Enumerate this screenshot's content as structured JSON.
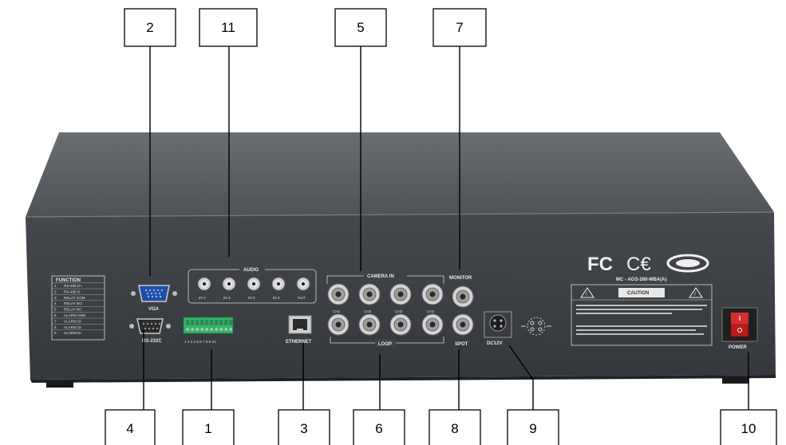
{
  "device": {
    "body_color": "#3f4247",
    "top_color": "#5b5e63",
    "terminal_color": "#37b56a"
  },
  "panel_labels": {
    "function_title": "FUNCTION",
    "function_rows": [
      {
        "num": "1",
        "text": "RS-485 D+"
      },
      {
        "num": "2",
        "text": "RS-485 D-"
      },
      {
        "num": "3",
        "text": "RELAY COM"
      },
      {
        "num": "4",
        "text": "RELAY NO"
      },
      {
        "num": "5",
        "text": "RELAY NC"
      },
      {
        "num": "6",
        "text": "ALARM GND"
      },
      {
        "num": "7",
        "text": "ALARM DI"
      },
      {
        "num": "8",
        "text": "ALARM DI"
      },
      {
        "num": "9",
        "text": "ALARM DI"
      }
    ],
    "vga": "VGA",
    "rs232c": "RS-232C",
    "terminal_numbers": "1 2 3 4 5 6 7 8 9 10",
    "audio": "AUDIO",
    "audio_ports": [
      "IN 1",
      "IN 2",
      "IN 3",
      "IN 4",
      "OUT"
    ],
    "ethernet": "ETHERNET",
    "camera_in": "CAMERA IN",
    "channels": [
      "CH1",
      "CH2",
      "CH3",
      "CH4"
    ],
    "loop": "LOOP",
    "monitor": "MONITOR",
    "spot": "SPOT",
    "dc12v": "DC12V",
    "model": "MC - AGS-280-MBA(A)",
    "caution": "CAUTION",
    "power": "POWER"
  },
  "callouts": [
    {
      "id": "2",
      "label": "2",
      "position": "top"
    },
    {
      "id": "11",
      "label": "11",
      "position": "top"
    },
    {
      "id": "5",
      "label": "5",
      "position": "top"
    },
    {
      "id": "7",
      "label": "7",
      "position": "top"
    },
    {
      "id": "4",
      "label": "4",
      "position": "bottom"
    },
    {
      "id": "1",
      "label": "1",
      "position": "bottom"
    },
    {
      "id": "3",
      "label": "3",
      "position": "bottom"
    },
    {
      "id": "6",
      "label": "6",
      "position": "bottom"
    },
    {
      "id": "8",
      "label": "8",
      "position": "bottom"
    },
    {
      "id": "9",
      "label": "9",
      "position": "bottom"
    },
    {
      "id": "10",
      "label": "10",
      "position": "bottom"
    }
  ]
}
